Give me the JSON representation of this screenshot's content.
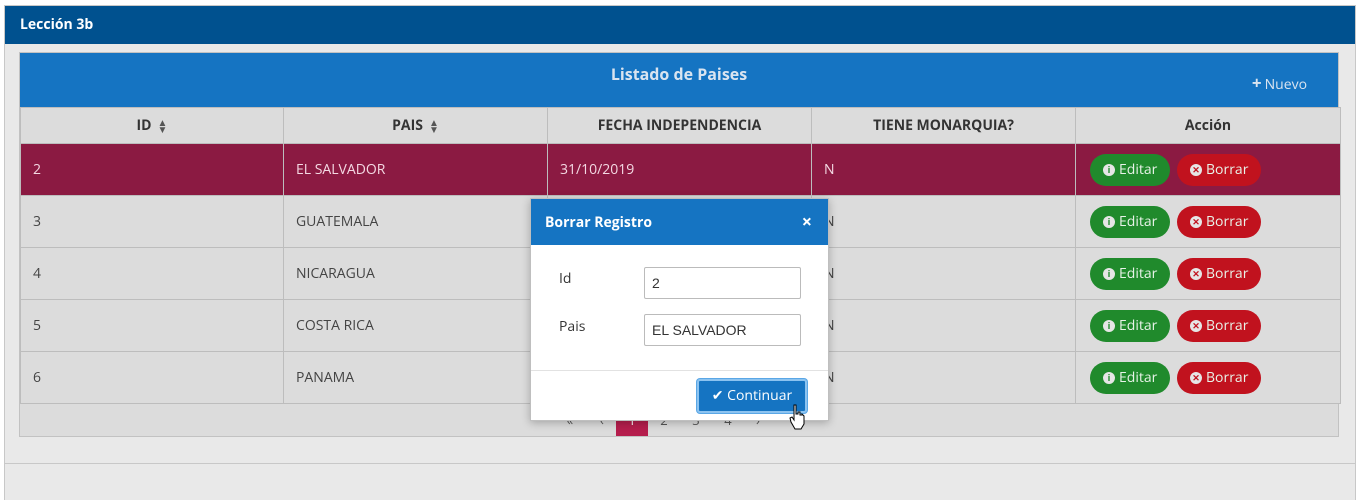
{
  "panel": {
    "title": "Lección 3b"
  },
  "grid": {
    "title": "Listado de Paises",
    "new_label": "Nuevo",
    "columns": [
      "ID",
      "PAIS",
      "FECHA INDEPENDENCIA",
      "TIENE MONARQUIA?",
      "Acción"
    ],
    "rows": [
      {
        "id": "2",
        "pais": "EL SALVADOR",
        "fecha": "31/10/2019",
        "monarquia": "N"
      },
      {
        "id": "3",
        "pais": "GUATEMALA",
        "fecha": "",
        "monarquia": "N"
      },
      {
        "id": "4",
        "pais": "NICARAGUA",
        "fecha": "",
        "monarquia": "N"
      },
      {
        "id": "5",
        "pais": "COSTA RICA",
        "fecha": "",
        "monarquia": "N"
      },
      {
        "id": "6",
        "pais": "PANAMA",
        "fecha": "",
        "monarquia": "N"
      }
    ],
    "edit_label": "Editar",
    "delete_label": "Borrar",
    "pager": {
      "current": "1",
      "pages": [
        "«",
        "‹",
        "1",
        "2",
        "3",
        "4",
        "›"
      ]
    }
  },
  "modal": {
    "title": "Borrar Registro",
    "close": "×",
    "id_label": "Id",
    "id_value": "2",
    "pais_label": "Pais",
    "pais_value": "EL SALVADOR",
    "continue_label": "Continuar"
  },
  "colors": {
    "header_blue": "#00518f",
    "grid_blue": "#1574c2",
    "selected_row": "#8b1a42",
    "edit_green": "#208a2c",
    "delete_red": "#c1121e"
  }
}
